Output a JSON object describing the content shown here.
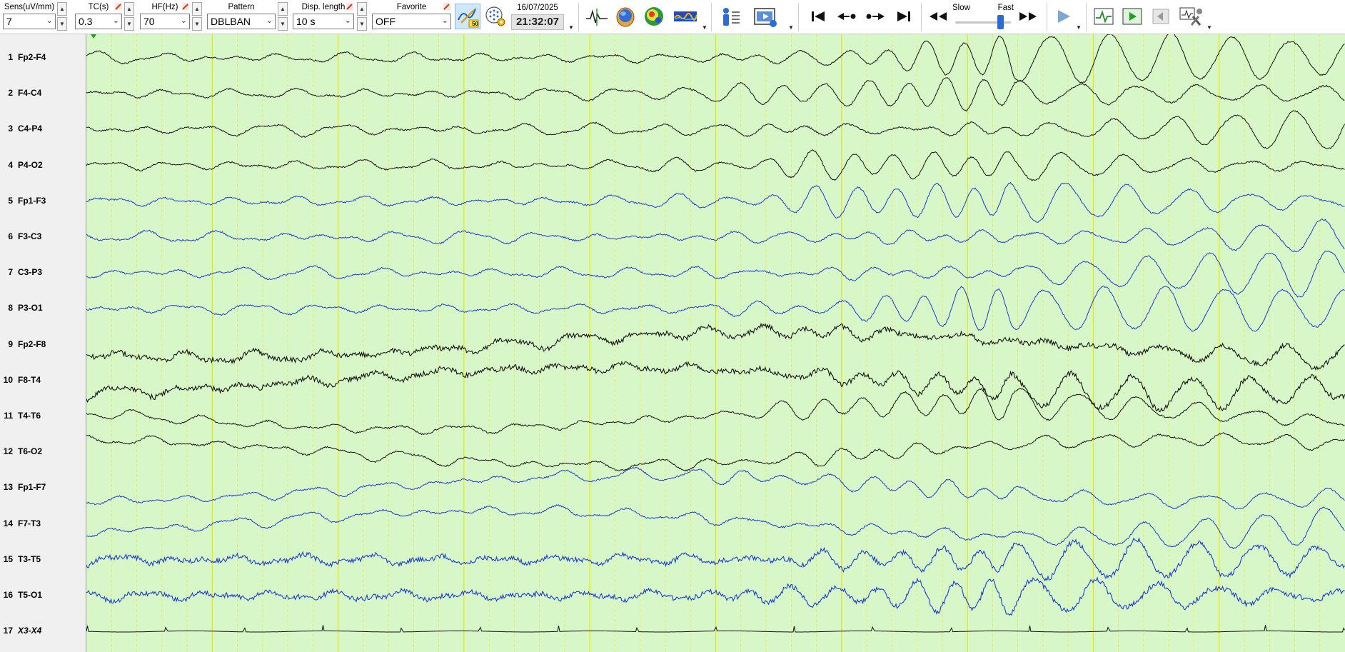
{
  "toolbar": {
    "sensitivity": {
      "label": "Sens(uV/mm)",
      "value": "7"
    },
    "time_constant": {
      "label": "TC(s)",
      "value": "0.3"
    },
    "high_filter": {
      "label": "HF(Hz)",
      "value": "70"
    },
    "pattern": {
      "label": "Pattern",
      "value": "DBLBAN"
    },
    "display_length": {
      "label": "Disp. length",
      "value": "10 s"
    },
    "favorite": {
      "label": "Favorite",
      "value": "OFF"
    },
    "notch_badge": "50",
    "date": "16/07/2025",
    "time": "21:32:07",
    "speed": {
      "slow_label": "Slow",
      "fast_label": "Fast",
      "level": 0.85
    }
  },
  "colors": {
    "trace_right": "#111111",
    "trace_left": "#1a3ccc",
    "background": "#d8f7c8",
    "second_line": "#e5e800",
    "minor_line": "#e8e84a",
    "toolbar_accent": "#2b6cd4",
    "marker_green": "#1da01d"
  },
  "channels": [
    {
      "num": "1",
      "name": "Fp2-F4",
      "side": "right"
    },
    {
      "num": "2",
      "name": "F4-C4",
      "side": "right"
    },
    {
      "num": "3",
      "name": "C4-P4",
      "side": "right"
    },
    {
      "num": "4",
      "name": "P4-O2",
      "side": "right"
    },
    {
      "num": "5",
      "name": "Fp1-F3",
      "side": "left"
    },
    {
      "num": "6",
      "name": "F3-C3",
      "side": "left"
    },
    {
      "num": "7",
      "name": "C3-P3",
      "side": "left"
    },
    {
      "num": "8",
      "name": "P3-O1",
      "side": "left"
    },
    {
      "num": "9",
      "name": "Fp2-F8",
      "side": "right"
    },
    {
      "num": "10",
      "name": "F8-T4",
      "side": "right"
    },
    {
      "num": "11",
      "name": "T4-T6",
      "side": "right"
    },
    {
      "num": "12",
      "name": "T6-O2",
      "side": "right"
    },
    {
      "num": "13",
      "name": "Fp1-F7",
      "side": "left"
    },
    {
      "num": "14",
      "name": "F7-T3",
      "side": "left"
    },
    {
      "num": "15",
      "name": "T3-T5",
      "side": "left"
    },
    {
      "num": "16",
      "name": "T5-O1",
      "side": "left"
    },
    {
      "num": "17",
      "name": "X3-X4",
      "side": "ecg"
    }
  ],
  "icons": {
    "notch_filter": "notch-filter-icon",
    "montage_grid": "montage-settings-icon",
    "waveform": "waveform-icon",
    "head_map": "head-map-icon",
    "topo_map": "topography-icon",
    "spectral": "spectral-icon",
    "patient_info": "patient-info-icon",
    "video": "video-icon",
    "first_page": "first-page-icon",
    "prev_page": "previous-page-icon",
    "next_page": "next-page-icon",
    "last_page": "last-page-icon",
    "rewind": "rewind-icon",
    "fast_forward": "fast-forward-icon",
    "play": "play-icon",
    "signal_view": "signal-view-icon",
    "play_green": "review-play-icon",
    "back_grey": "review-back-icon",
    "tools": "tools-icon"
  }
}
